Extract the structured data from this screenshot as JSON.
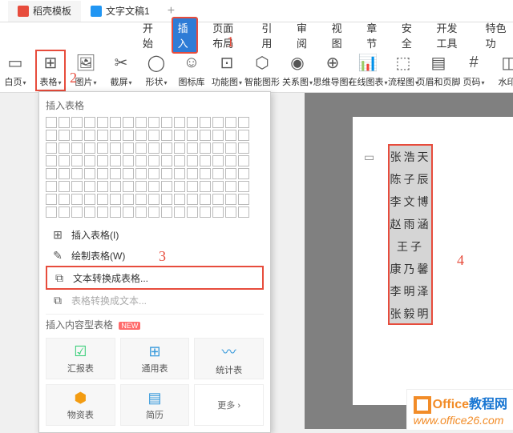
{
  "tabs": {
    "items": [
      {
        "label": "稻壳模板"
      },
      {
        "label": "文字文稿1"
      }
    ]
  },
  "ribbon": {
    "tabs": [
      "开始",
      "插入",
      "页面布局",
      "引用",
      "审阅",
      "视图",
      "章节",
      "安全",
      "开发工具",
      "特色功"
    ],
    "active_index": 1
  },
  "toolbar": {
    "blank_page": "白页",
    "table": "表格",
    "picture": "图片",
    "screenshot": "截屏",
    "shape": "形状",
    "icon_lib": "图标库",
    "function": "功能图",
    "smart_graphic": "智能图形",
    "relation": "关系图",
    "mindmap": "思维导图",
    "online_chart": "在线图表",
    "flowchart": "流程图",
    "header_footer": "页眉和页脚",
    "page_number": "页码",
    "watermark": "水印"
  },
  "table_menu": {
    "title": "插入表格",
    "insert_table": "插入表格(I)",
    "draw_table": "绘制表格(W)",
    "text_to_table": "文本转换成表格...",
    "table_to_text": "表格转换成文本...",
    "content_templates": "插入内容型表格",
    "new_label": "NEW",
    "templates": {
      "report": "汇报表",
      "general": "通用表",
      "stats": "统计表",
      "asset": "物资表",
      "resume": "简历",
      "more": "更多"
    }
  },
  "document": {
    "names": [
      "张浩天",
      "陈子辰",
      "李文博",
      "赵雨涵",
      "王子",
      "康乃馨",
      "李明泽",
      "张毅明"
    ]
  },
  "annotations": {
    "a1": "1",
    "a2": "2",
    "a3": "3",
    "a4": "4"
  },
  "logo": {
    "brand": "Office",
    "suffix": "教程网",
    "url": "www.office26.com"
  }
}
